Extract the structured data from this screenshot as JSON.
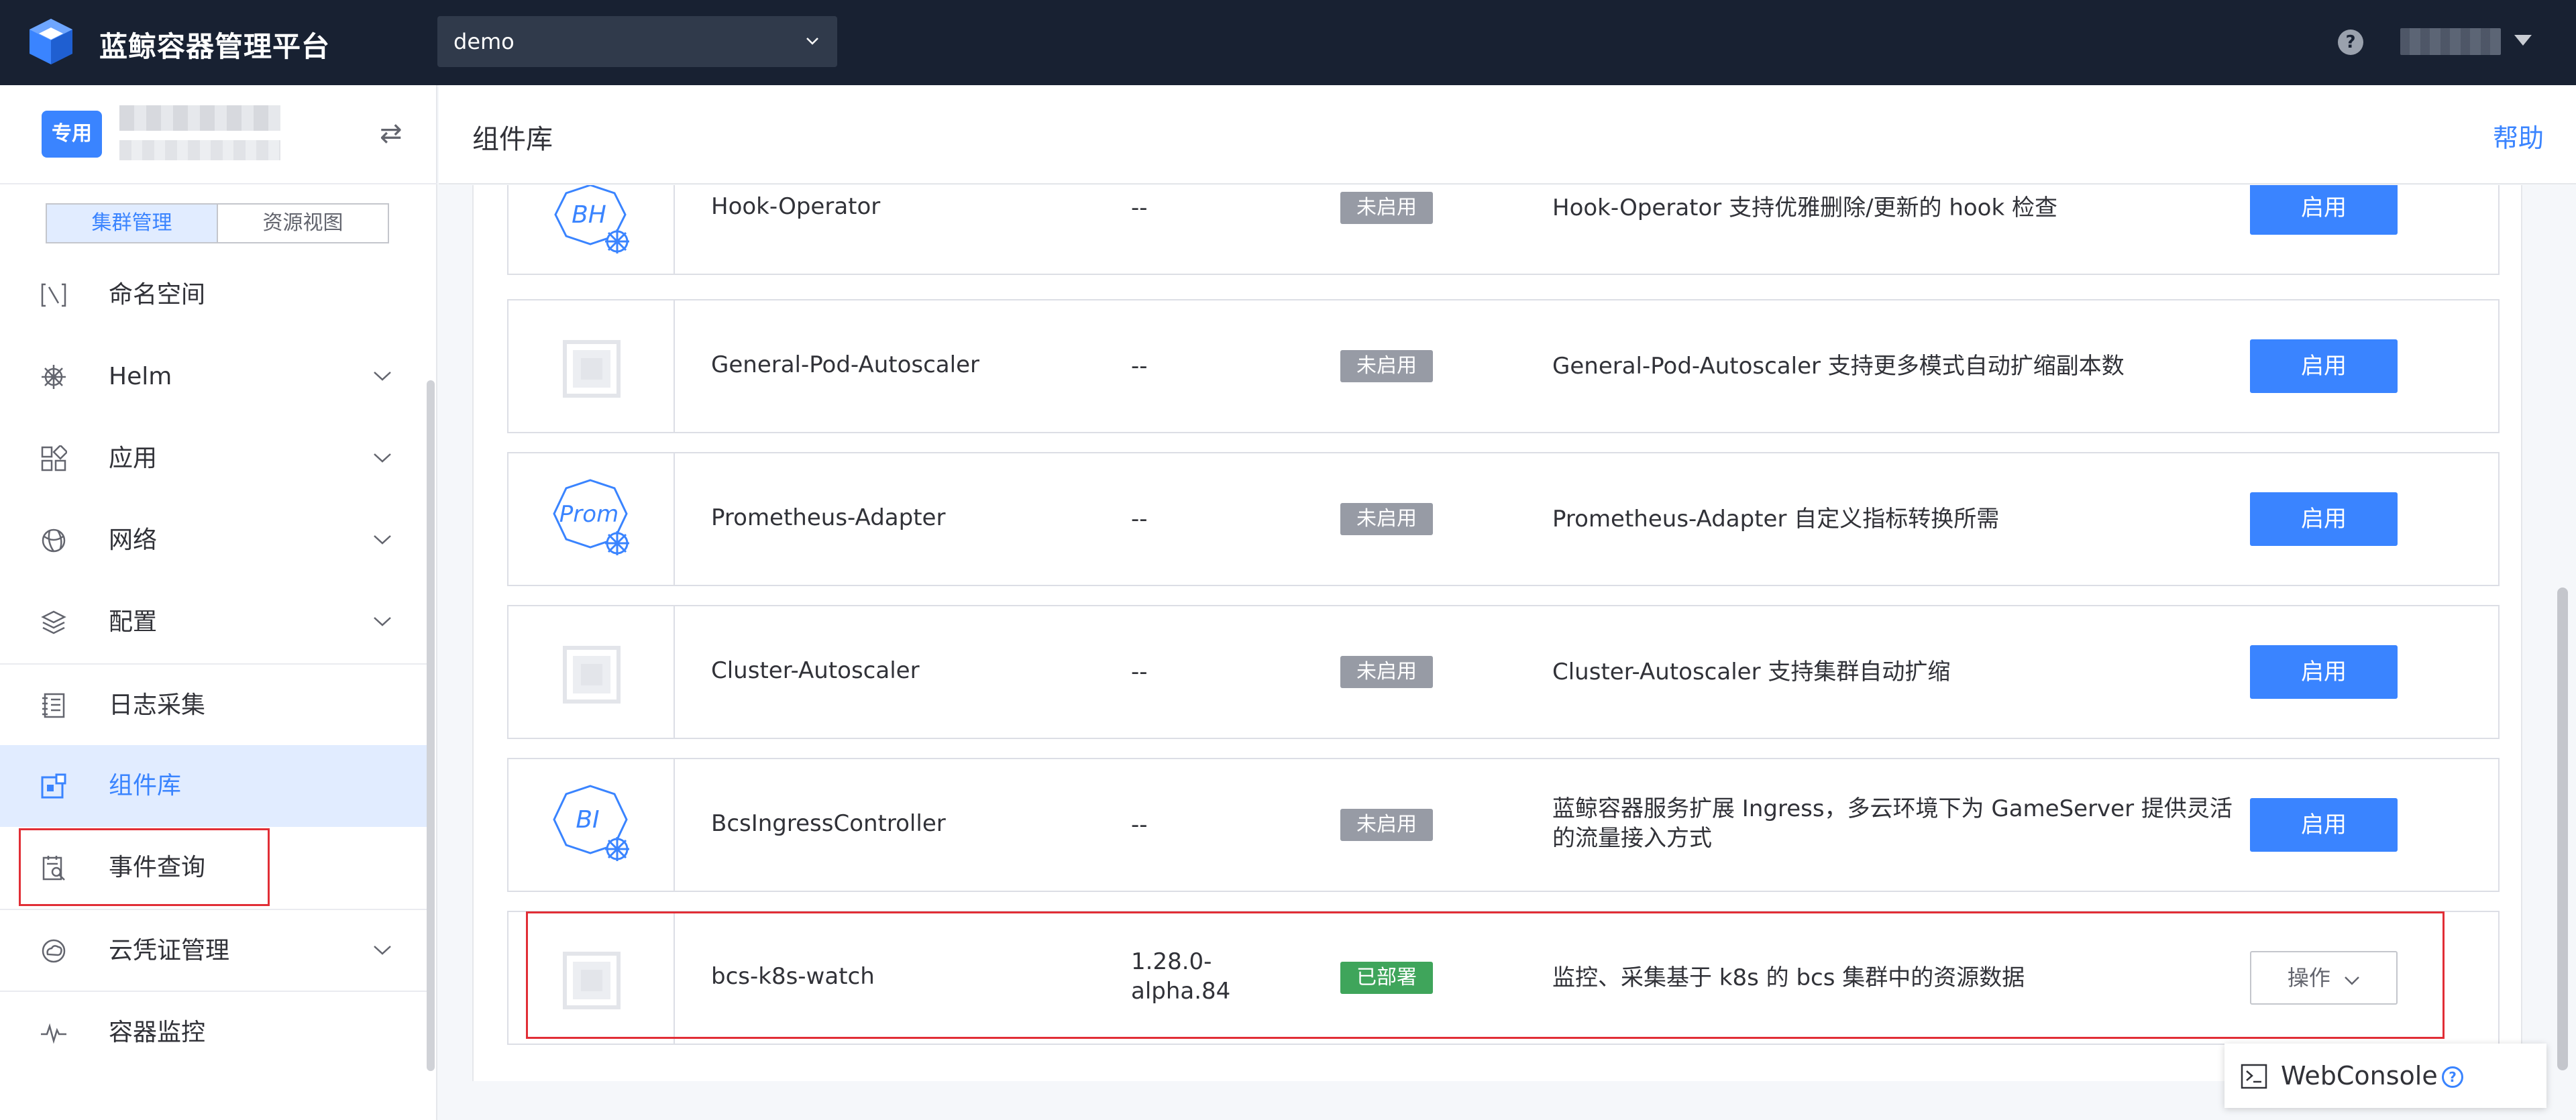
{
  "app": {
    "title": "蓝鲸容器管理平台",
    "project": "demo"
  },
  "sidebar": {
    "cluster_tag": "专用",
    "view_tabs": [
      "集群管理",
      "资源视图"
    ],
    "items": [
      {
        "label": "命名空间",
        "icon": "namespace-icon",
        "has_arrow": false
      },
      {
        "label": "Helm",
        "icon": "helm-icon",
        "has_arrow": true
      },
      {
        "label": "应用",
        "icon": "apps-icon",
        "has_arrow": true
      },
      {
        "label": "网络",
        "icon": "network-icon",
        "has_arrow": true
      },
      {
        "label": "配置",
        "icon": "config-icon",
        "has_arrow": true
      },
      {
        "label": "日志采集",
        "icon": "log-icon",
        "has_arrow": false
      },
      {
        "label": "组件库",
        "icon": "component-icon",
        "has_arrow": false,
        "active": true
      },
      {
        "label": "事件查询",
        "icon": "event-icon",
        "has_arrow": false
      },
      {
        "label": "云凭证管理",
        "icon": "credential-icon",
        "has_arrow": true
      },
      {
        "label": "容器监控",
        "icon": "monitor-icon",
        "has_arrow": false
      }
    ]
  },
  "header": {
    "title": "组件库",
    "help": "帮助"
  },
  "components": [
    {
      "logo_text": "BH",
      "name": "Hook-Operator",
      "version": "--",
      "status": "未启用",
      "desc": "Hook-Operator 支持优雅删除/更新的 hook 检查",
      "action": "启用"
    },
    {
      "logo_text": "",
      "name": "General-Pod-Autoscaler",
      "version": "--",
      "status": "未启用",
      "desc": "General-Pod-Autoscaler 支持更多模式自动扩缩副本数",
      "action": "启用"
    },
    {
      "logo_text": "Prom",
      "name": "Prometheus-Adapter",
      "version": "--",
      "status": "未启用",
      "desc": "Prometheus-Adapter 自定义指标转换所需",
      "action": "启用"
    },
    {
      "logo_text": "",
      "name": "Cluster-Autoscaler",
      "version": "--",
      "status": "未启用",
      "desc": "Cluster-Autoscaler 支持集群自动扩缩",
      "action": "启用"
    },
    {
      "logo_text": "BI",
      "name": "BcsIngressController",
      "version": "--",
      "status": "未启用",
      "desc": "蓝鲸容器服务扩展 Ingress，多云环境下为 GameServer 提供灵活的流量接入方式",
      "action": "启用"
    },
    {
      "logo_text": "",
      "name": "bcs-k8s-watch",
      "version": "1.28.0-alpha.84",
      "status": "已部署",
      "desc": "监控、采集基于 k8s 的 bcs 集群中的资源数据",
      "action": "操作"
    }
  ],
  "webconsole": {
    "label": "WebConsole"
  },
  "colors": {
    "primary": "#3a84ff",
    "topbar": "#182132",
    "status_off": "#979ba5",
    "status_on": "#3fa55b",
    "highlight": "#e12e36"
  }
}
